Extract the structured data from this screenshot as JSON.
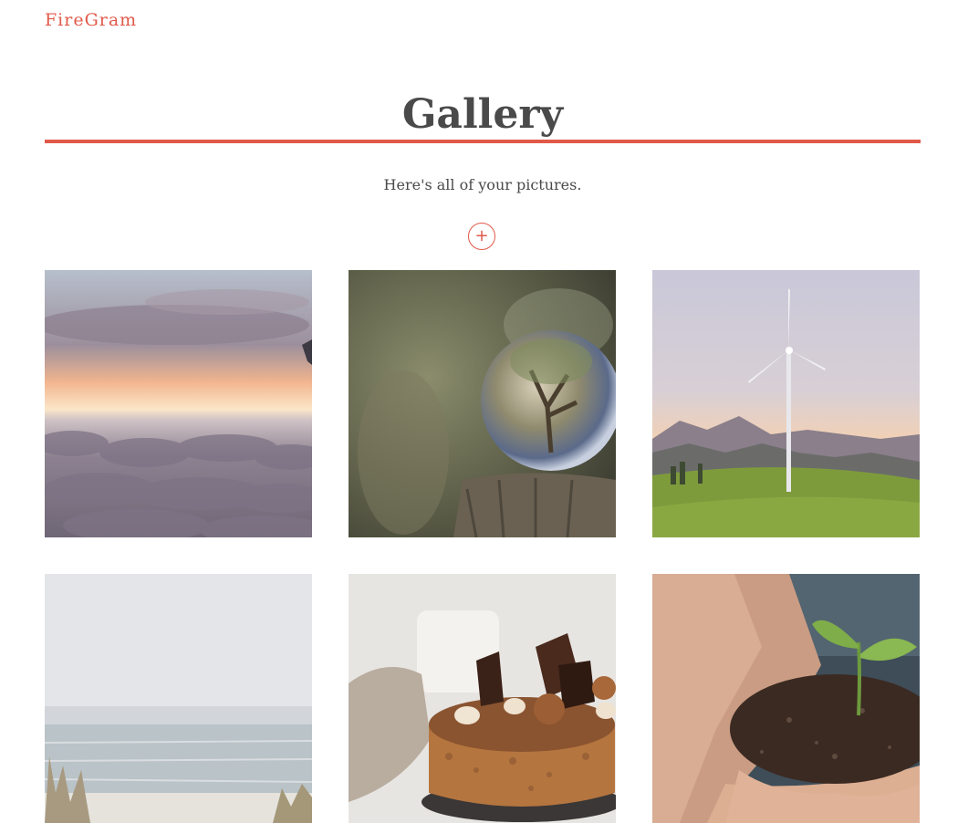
{
  "nav": {
    "brand": "FireGram"
  },
  "header": {
    "title": "Gallery",
    "subtitle": "Here's all of your pictures."
  },
  "actions": {
    "add_icon": "plus-icon",
    "add_glyph": "+"
  },
  "colors": {
    "accent": "#e0594a",
    "text": "#4a4a4a",
    "background": "#ffffff"
  },
  "gallery": {
    "images": [
      {
        "subject": "clouds-sunset"
      },
      {
        "subject": "crystal-ball-on-stump"
      },
      {
        "subject": "wind-turbine"
      },
      {
        "subject": "sea-shore"
      },
      {
        "subject": "chocolate-cake"
      },
      {
        "subject": "seedling-in-hands"
      }
    ]
  }
}
